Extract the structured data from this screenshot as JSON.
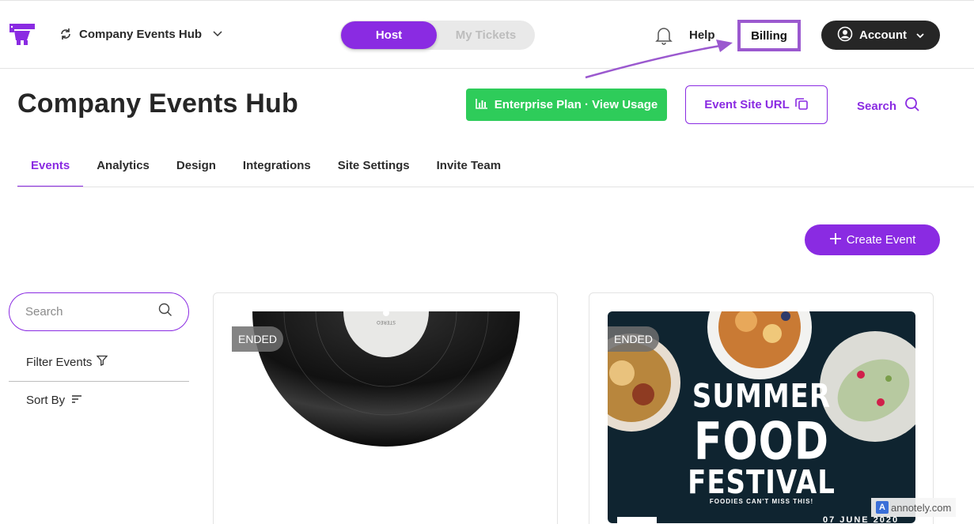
{
  "header": {
    "org_name": "Company Events Hub",
    "mode_host": "Host",
    "mode_tickets": "My Tickets",
    "help": "Help",
    "billing": "Billing",
    "account": "Account"
  },
  "page": {
    "title": "Company Events Hub",
    "plan_button": "Enterprise Plan · View Usage",
    "site_url_button": "Event Site URL",
    "search_label": "Search"
  },
  "tabs": [
    {
      "label": "Events",
      "active": true
    },
    {
      "label": "Analytics"
    },
    {
      "label": "Design"
    },
    {
      "label": "Integrations"
    },
    {
      "label": "Site Settings"
    },
    {
      "label": "Invite Team"
    }
  ],
  "create_event": "Create Event",
  "sidebar": {
    "search_placeholder": "Search",
    "filter_label": "Filter Events",
    "sort_label": "Sort By"
  },
  "events": [
    {
      "status": "ENDED",
      "image": "vinyl-record"
    },
    {
      "status": "ENDED",
      "image": "food-festival-poster",
      "poster": {
        "line1": "SUMMER",
        "line2": "FOOD",
        "line3": "FESTIVAL",
        "tagline": "FOODIES CAN'T MISS THIS!",
        "date": "07 JUNE 2020"
      }
    }
  ],
  "watermark": "annotely.com",
  "colors": {
    "brand_purple": "#8a2be2",
    "plan_green": "#2ecc5a",
    "account_dark": "#262626",
    "highlight_box": "#9b59cf"
  }
}
